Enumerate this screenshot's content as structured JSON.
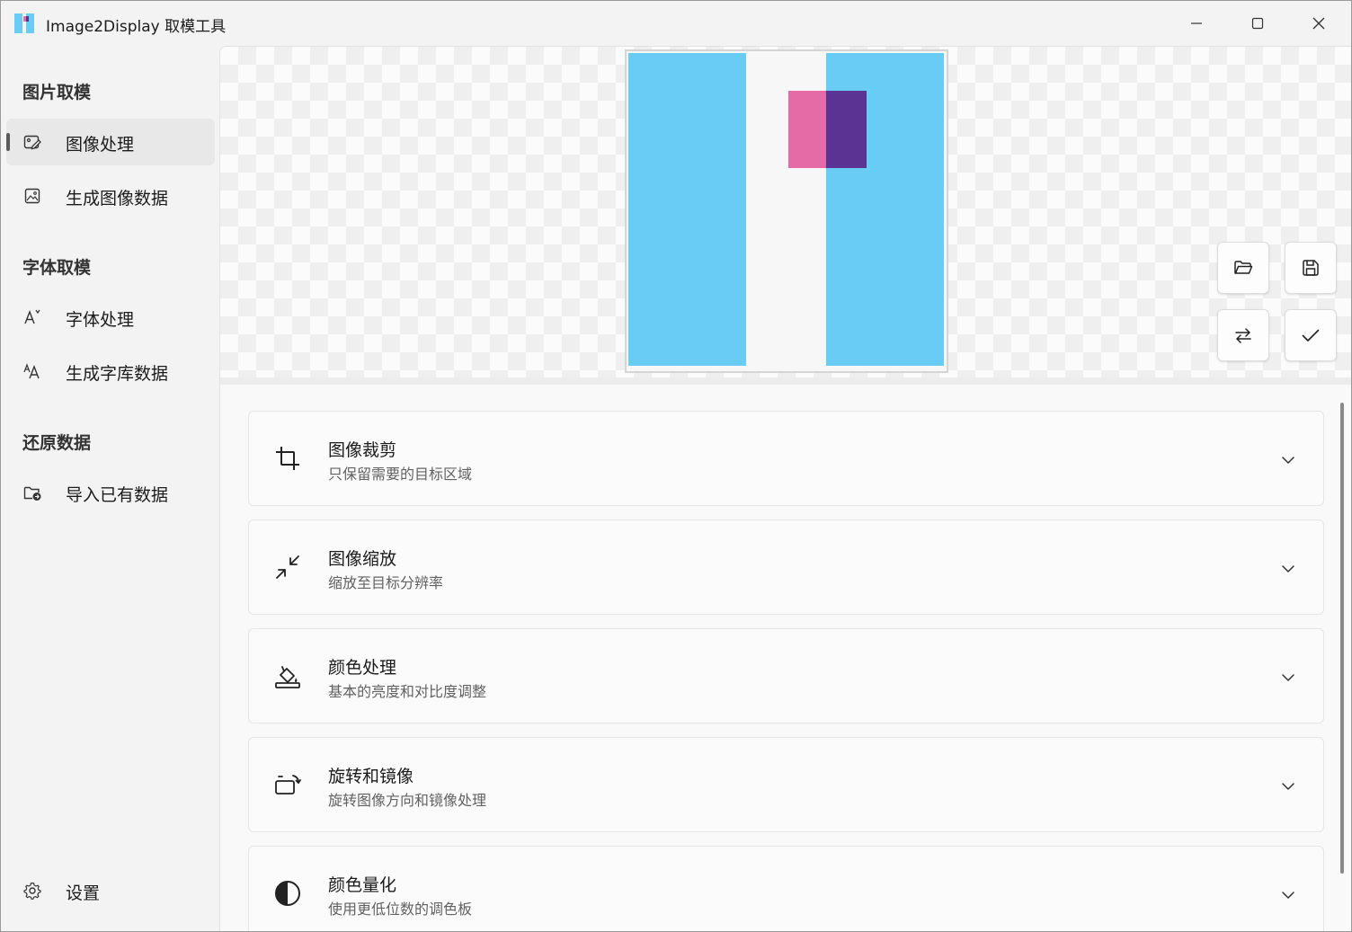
{
  "window": {
    "title": "Image2Display 取模工具",
    "controls": {
      "minimize": "minimize-icon",
      "maximize": "maximize-icon",
      "close": "close-icon"
    }
  },
  "sidebar": {
    "sections": [
      {
        "title": "图片取模",
        "items": [
          {
            "label": "图像处理",
            "icon": "image-edit-icon",
            "active": true
          },
          {
            "label": "生成图像数据",
            "icon": "image-icon",
            "active": false
          }
        ]
      },
      {
        "title": "字体取模",
        "items": [
          {
            "label": "字体处理",
            "icon": "font-edit-icon",
            "active": false
          },
          {
            "label": "生成字库数据",
            "icon": "font-size-icon",
            "active": false
          }
        ]
      },
      {
        "title": "还原数据",
        "items": [
          {
            "label": "导入已有数据",
            "icon": "folder-import-icon",
            "active": false
          }
        ]
      }
    ],
    "footer": {
      "label": "设置",
      "icon": "gear-icon"
    }
  },
  "preview": {
    "colors": {
      "cyan": "#68ccf5",
      "pink": "#e56ba6",
      "purple": "#5b3392"
    },
    "toolbar": [
      {
        "name": "open-folder-button",
        "icon": "folder-open-icon"
      },
      {
        "name": "save-button",
        "icon": "save-icon"
      },
      {
        "name": "swap-button",
        "icon": "swap-icon"
      },
      {
        "name": "confirm-button",
        "icon": "checkmark-icon"
      }
    ]
  },
  "cards": [
    {
      "title": "图像裁剪",
      "subtitle": "只保留需要的目标区域",
      "icon": "crop-icon"
    },
    {
      "title": "图像缩放",
      "subtitle": "缩放至目标分辨率",
      "icon": "shrink-arrows-icon"
    },
    {
      "title": "颜色处理",
      "subtitle": "基本的亮度和对比度调整",
      "icon": "paint-bucket-icon"
    },
    {
      "title": "旋转和镜像",
      "subtitle": "旋转图像方向和镜像处理",
      "icon": "rotate-icon"
    },
    {
      "title": "颜色量化",
      "subtitle": "使用更低位数的调色板",
      "icon": "contrast-icon"
    }
  ],
  "theme": {
    "accent": "#5a5a5a",
    "sidebar_bg": "#f3f3f3",
    "content_bg": "#f9f9f9"
  }
}
